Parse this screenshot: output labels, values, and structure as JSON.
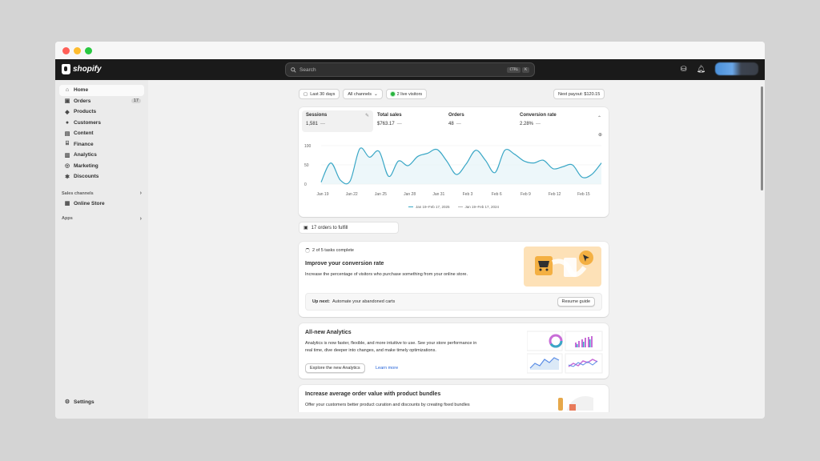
{
  "app": {
    "brand": "shopify"
  },
  "search": {
    "placeholder": "Search",
    "shortcut_key1": "CTRL",
    "shortcut_key2": "K"
  },
  "sidebar": {
    "items": [
      {
        "label": "Home",
        "icon": "home-icon"
      },
      {
        "label": "Orders",
        "icon": "inbox-icon",
        "count": "17"
      },
      {
        "label": "Products",
        "icon": "tag-icon"
      },
      {
        "label": "Customers",
        "icon": "person-icon"
      },
      {
        "label": "Content",
        "icon": "content-icon"
      },
      {
        "label": "Finance",
        "icon": "bank-icon"
      },
      {
        "label": "Analytics",
        "icon": "bar-chart-icon"
      },
      {
        "label": "Marketing",
        "icon": "target-icon"
      },
      {
        "label": "Discounts",
        "icon": "discount-icon"
      }
    ],
    "sales_channels_label": "Sales channels",
    "online_store_label": "Online Store",
    "apps_label": "Apps",
    "settings_label": "Settings"
  },
  "filters": {
    "date": "Last 30 days",
    "channels": "All channels",
    "live": "2 live visitors",
    "payout": "Next payout: $120.15"
  },
  "metrics": [
    {
      "label": "Sessions",
      "value": "1,581"
    },
    {
      "label": "Total sales",
      "value": "$763.17"
    },
    {
      "label": "Orders",
      "value": "48"
    },
    {
      "label": "Conversion rate",
      "value": "2.28%"
    }
  ],
  "chart_data": {
    "type": "line",
    "x": [
      "Jan 19",
      "Jan 20",
      "Jan 21",
      "Jan 22",
      "Jan 23",
      "Jan 24",
      "Jan 25",
      "Jan 26",
      "Jan 27",
      "Jan 28",
      "Jan 29",
      "Jan 30",
      "Jan 31",
      "Feb 1",
      "Feb 2",
      "Feb 3",
      "Feb 4",
      "Feb 5",
      "Feb 6",
      "Feb 7",
      "Feb 8",
      "Feb 9",
      "Feb 10",
      "Feb 11",
      "Feb 12",
      "Feb 13",
      "Feb 14",
      "Feb 15",
      "Feb 16",
      "Feb 17"
    ],
    "x_ticks": [
      "Jan 19",
      "Jan 22",
      "Jan 25",
      "Jan 28",
      "Jan 31",
      "Feb 3",
      "Feb 6",
      "Feb 9",
      "Feb 12",
      "Feb 15"
    ],
    "y_ticks": [
      "100",
      "50",
      "0"
    ],
    "ylim": [
      0,
      100
    ],
    "series": [
      {
        "name": "Jan 19–Feb 17, 2025",
        "color": "#3aa7c6",
        "values": [
          5,
          55,
          10,
          8,
          92,
          70,
          85,
          20,
          60,
          48,
          72,
          80,
          90,
          60,
          25,
          52,
          88,
          62,
          30,
          88,
          78,
          60,
          55,
          62,
          40,
          45,
          50,
          18,
          25,
          55
        ]
      },
      {
        "name": "Jan 19–Feb 17, 2024",
        "color": "#b5b5b5",
        "values": []
      }
    ]
  },
  "fulfill": {
    "label": "17 orders to fulfill"
  },
  "conversion_card": {
    "tasks": "2 of 5 tasks complete",
    "title": "Improve your conversion rate",
    "text": "Increase the percentage of visitors who purchase something from your online store.",
    "upnext_label": "Up next:",
    "upnext_text": "Automate your abandoned carts",
    "button": "Resume guide"
  },
  "analytics_card": {
    "title": "All-new Analytics",
    "text1": "Analytics is now faster, flexible, and more intuitive to use. See your store performance in",
    "text2": "real time, dive deeper into changes, and make timely optimizations.",
    "button": "Explore the new Analytics",
    "link": "Learn more"
  },
  "bundle_card": {
    "title": "Increase average order value with product bundles",
    "text": "Offer your customers better product curation and discounts by creating fixed bundles"
  }
}
